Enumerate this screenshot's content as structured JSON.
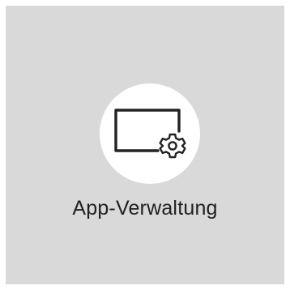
{
  "app": {
    "label": "App-Verwaltung",
    "icon": "screen-gear-icon"
  },
  "colors": {
    "tile_background": "#d9d9d9",
    "circle_background": "#ffffff",
    "icon_stroke": "#222222",
    "label_text": "#202020"
  }
}
